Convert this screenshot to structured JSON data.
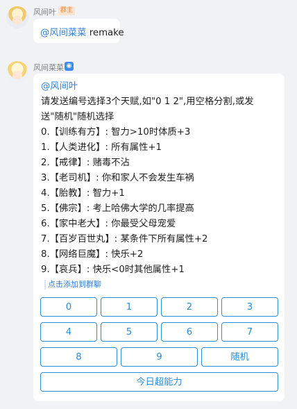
{
  "message1": {
    "nickname": "风间叶",
    "role_badge": "群主",
    "mention": "@风间菜菜",
    "text": " remake"
  },
  "message2": {
    "nickname": "风间菜菜",
    "bot_badge_icon": "robot-icon",
    "mention": "@风间叶",
    "lines": [
      "请发送编号选择3个天赋,如\"0 1 2\",用空格分割,或发",
      "送\"随机\"随机选择",
      "0.【训练有方】: 智力>10时体质+3",
      "1.【人类进化】: 所有属性+1",
      "2.【戒律】: 赌毒不沾",
      "3.【老司机】: 你和家人不会发生车祸",
      "4.【胎教】: 智力+1",
      "5.【佛宗】: 考上哈佛大学的几率提高",
      "6.【家中老大】: 你最受父母宠爱",
      "7.【百岁百世丸】: 某条件下所有属性+2",
      "8.【网络巨魔】: 快乐+2",
      "9.【哀兵】: 快乐<0时其他属性+1"
    ],
    "add_to_group_link": "点击添加到群聊",
    "keyboard": {
      "row1": [
        "0",
        "1",
        "2",
        "3"
      ],
      "row2": [
        "4",
        "5",
        "6",
        "7"
      ],
      "row3": [
        "8",
        "9",
        "随机"
      ],
      "row4": [
        "今日超能力"
      ]
    }
  }
}
